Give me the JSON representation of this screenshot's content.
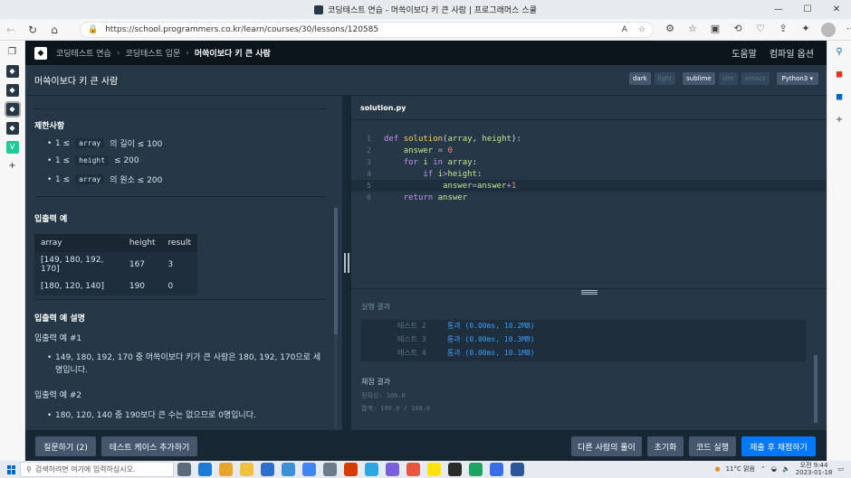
{
  "browser": {
    "tab_title": "코딩테스트 연습 - 머쓱이보다 키 큰 사람 | 프로그래머스 스쿨",
    "url": "https://school.programmers.co.kr/learn/courses/30/lessons/120585",
    "window_controls": [
      "—",
      "☐",
      "✕"
    ]
  },
  "nav": {
    "crumbs": [
      "코딩테스트 연습",
      "코딩테스트 입문",
      "머쓱이보다 키 큰 사람"
    ],
    "help": "도움말",
    "compile_options": "컴파일 옵션"
  },
  "lesson": {
    "title": "머쓱이보다 키 큰 사람",
    "themes": [
      "dark",
      "light"
    ],
    "keymaps": [
      "sublime",
      "vim",
      "emacs"
    ],
    "language": "Python3"
  },
  "problem": {
    "constraints_heading": "제한사항",
    "constraints": [
      {
        "pre": "1 ≤",
        "code": "array",
        "post": "의 길이 ≤ 100"
      },
      {
        "pre": "1 ≤",
        "code": "height",
        "post": "≤ 200"
      },
      {
        "pre": "1 ≤",
        "code": "array",
        "post": "의 원소 ≤ 200"
      }
    ],
    "io_heading": "입출력 예",
    "io_columns": [
      "array",
      "height",
      "result"
    ],
    "io_rows": [
      [
        "[149, 180, 192, 170]",
        "167",
        "3"
      ],
      [
        "[180, 120, 140]",
        "190",
        "0"
      ]
    ],
    "io_desc_heading": "입출력 예 설명",
    "example1_title": "입출력 예 #1",
    "example1_text": "149, 180, 192, 170 중 머쓱이보다 키가 큰 사람은 180, 192, 170으로 세 명입니다.",
    "example2_title": "입출력 예 #2",
    "example2_text": "180, 120, 140 중 190보다 큰 수는 없으므로 0명입니다."
  },
  "editor": {
    "file_name": "solution.py",
    "line_numbers": [
      "1",
      "2",
      "3",
      "4",
      "5",
      "6"
    ]
  },
  "results": {
    "title": "실행 결과",
    "tests": [
      {
        "label": "테스트 2",
        "status": "통과 (0.00ms, 10.2MB)"
      },
      {
        "label": "테스트 3",
        "status": "통과 (0.00ms, 10.3MB)"
      },
      {
        "label": "테스트 4",
        "status": "통과 (0.00ms, 10.1MB)"
      }
    ],
    "final_heading": "채점 결과",
    "accuracy": "정확성: 100.0",
    "total": "합계: 100.0 / 100.0"
  },
  "actions": {
    "questions": "질문하기 (2)",
    "add_testcase": "테스트 케이스 추가하기",
    "others_solutions": "다른 사람의 풀이",
    "reset": "초기화",
    "run": "코드 실행",
    "submit": "제출 후 채점하기"
  },
  "taskbar": {
    "search_placeholder": "검색하려면 여기에 입력하십시오.",
    "weather": "11°C 맑음",
    "time": "오전 9:44",
    "date": "2023-01-18"
  }
}
